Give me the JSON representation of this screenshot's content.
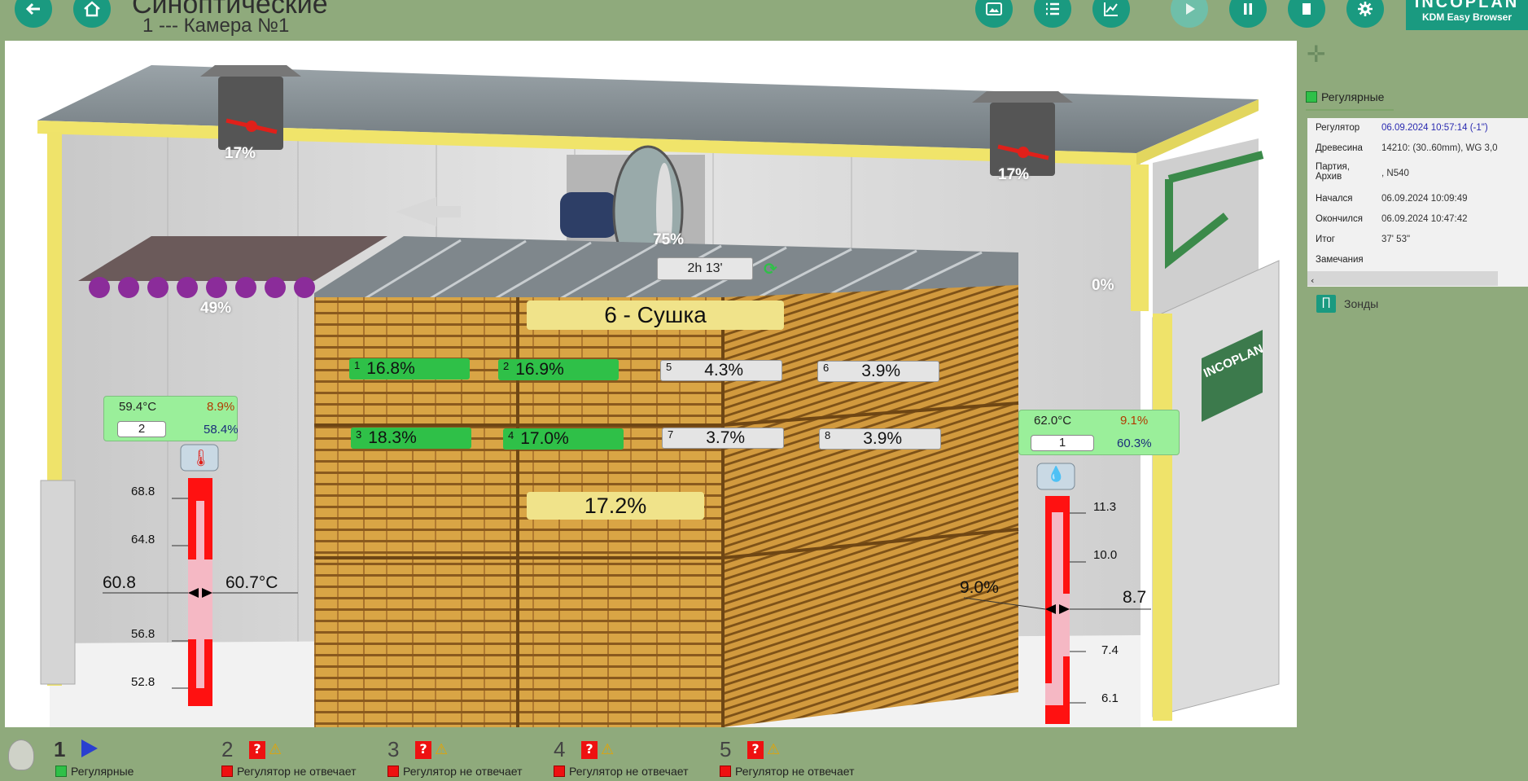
{
  "header": {
    "title": "Синоптические",
    "subtitle": "1 --- Камера №1",
    "logo_main": "INCOPLAN",
    "logo_sub": "KDM Easy Browser"
  },
  "scene": {
    "vent_left": "17%",
    "vent_right": "17%",
    "fan": "75%",
    "heater": "49%",
    "spray": "0%",
    "timer": "2h 13'",
    "phase": "6 - Сушка",
    "average": "17.2%",
    "door_logo": "INCOPLAN",
    "probes": [
      {
        "n": "1",
        "v": "16.8%",
        "state": "ok"
      },
      {
        "n": "2",
        "v": "16.9%",
        "state": "ok"
      },
      {
        "n": "3",
        "v": "18.3%",
        "state": "ok"
      },
      {
        "n": "4",
        "v": "17.0%",
        "state": "ok"
      },
      {
        "n": "5",
        "v": "4.3%",
        "state": "off"
      },
      {
        "n": "6",
        "v": "3.9%",
        "state": "off"
      },
      {
        "n": "7",
        "v": "3.7%",
        "state": "off"
      },
      {
        "n": "8",
        "v": "3.9%",
        "state": "off"
      }
    ],
    "box_left": {
      "temp": "59.4°C",
      "emc": "8.9%",
      "id": "2",
      "rh": "58.4%"
    },
    "box_right": {
      "temp": "62.0°C",
      "emc": "9.1%",
      "id": "1",
      "rh": "60.3%"
    },
    "gauge_left": {
      "ticks": [
        "68.8",
        "64.8",
        "56.8",
        "52.8"
      ],
      "setpoint": "60.8",
      "actual": "60.7°C"
    },
    "gauge_right": {
      "ticks": [
        "11.3",
        "10.0",
        "7.4",
        "6.1"
      ],
      "setpoint": "9.0%",
      "actual": "8.7"
    }
  },
  "panel": {
    "tab_label": "Регулярные",
    "rows": [
      {
        "k": "Регулятор",
        "v": "06.09.2024 10:57:14 (-1\")"
      },
      {
        "k": "Древесина",
        "v": "14210:  (30..60mm), WG 3,0"
      },
      {
        "k": "Партия, Архив",
        "v": ", N540"
      },
      {
        "k": "Начался",
        "v": "06.09.2024 10:09:49"
      },
      {
        "k": "Окончился",
        "v": "06.09.2024 10:47:42"
      },
      {
        "k": "Итог",
        "v": "37' 53\""
      },
      {
        "k": "Замечания",
        "v": ""
      }
    ],
    "probes_label": "Зонды"
  },
  "chambers": [
    {
      "n": "1",
      "status": "Регулярные",
      "state": "ok"
    },
    {
      "n": "2",
      "status": "Регулятор не отвечает",
      "state": "error"
    },
    {
      "n": "3",
      "status": "Регулятор не отвечает",
      "state": "error"
    },
    {
      "n": "4",
      "status": "Регулятор не отвечает",
      "state": "error"
    },
    {
      "n": "5",
      "status": "Регулятор не отвечает",
      "state": "error"
    }
  ],
  "colors": {
    "accent": "#1a9a80",
    "background": "#8faa7c",
    "ok": "#2fc048",
    "error": "#ee1111",
    "gauge": "#ee1111"
  }
}
